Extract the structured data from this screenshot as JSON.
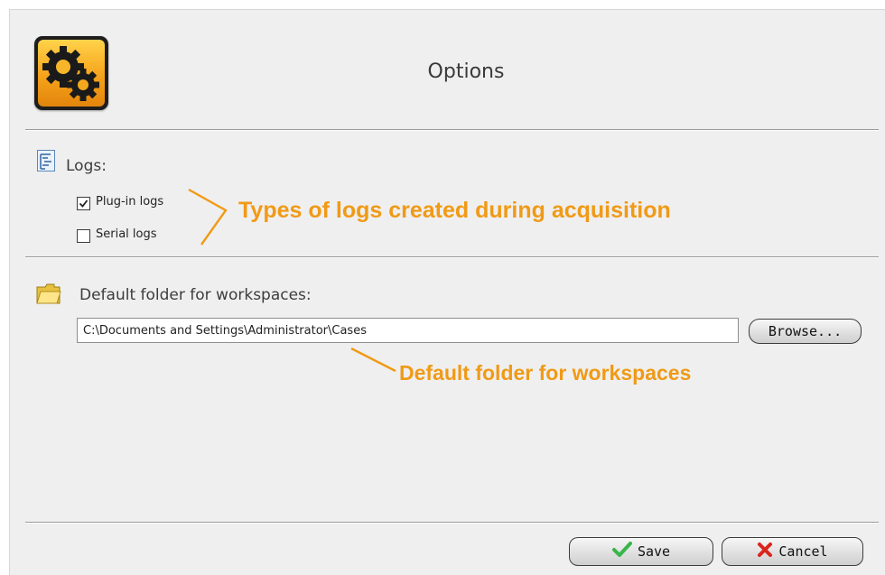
{
  "header": {
    "title": "Options",
    "app_icon": "gears-icon"
  },
  "logs": {
    "section_label": "Logs:",
    "icon": "log-document-icon",
    "items": [
      {
        "label": "Plug-in logs",
        "checked": true
      },
      {
        "label": "Serial logs",
        "checked": false
      }
    ],
    "annotation": "Types of logs created during acquisition"
  },
  "workspace": {
    "section_label": "Default folder for workspaces:",
    "icon": "folder-icon",
    "path_value": "C:\\Documents and Settings\\Administrator\\Cases",
    "browse_label": "Browse...",
    "annotation": "Default folder for workspaces"
  },
  "footer": {
    "save_label": "Save",
    "cancel_label": "Cancel"
  },
  "colors": {
    "annotation": "#f09a16",
    "background": "#efefef",
    "save_check": "#39b54a",
    "cancel_x": "#d9261c"
  }
}
